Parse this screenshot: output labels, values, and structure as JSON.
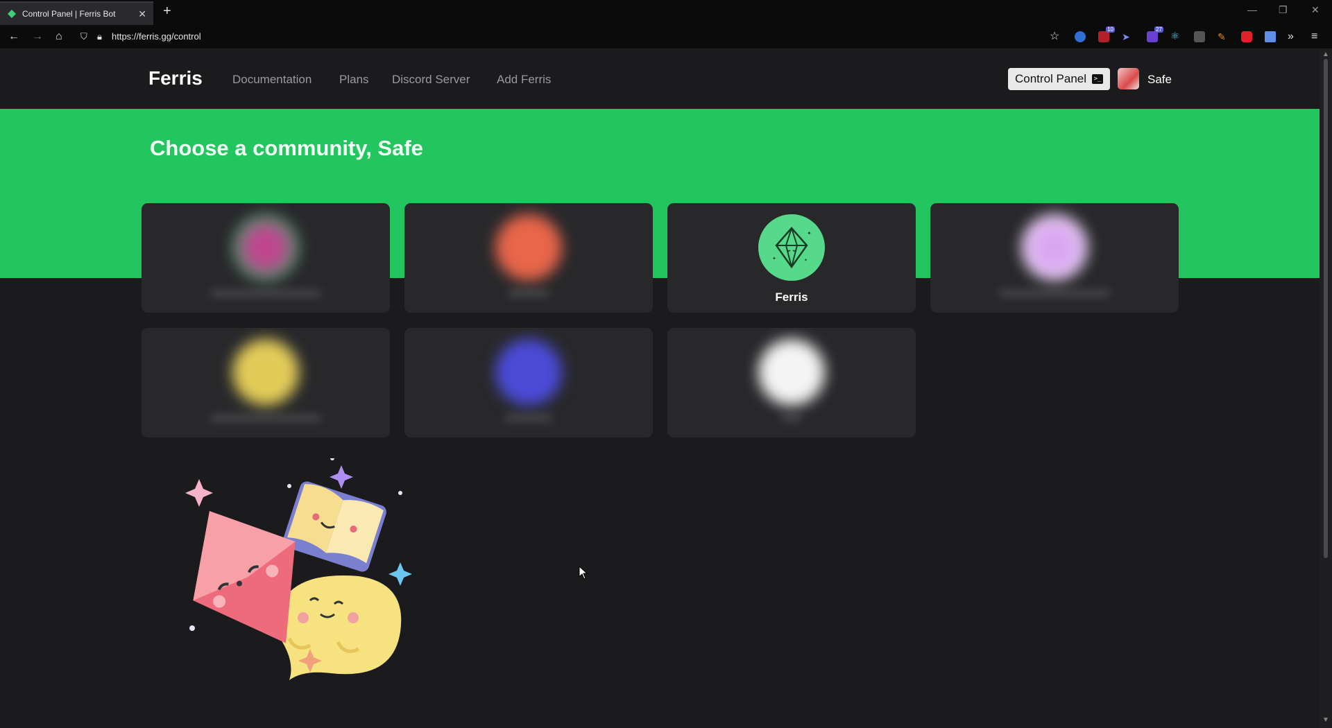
{
  "browser": {
    "tab_title": "Control Panel | Ferris Bot",
    "url": "https://ferris.gg/control",
    "extension_badges": [
      "10",
      "27"
    ]
  },
  "site": {
    "brand": "Ferris",
    "nav": [
      "Documentation",
      "Plans",
      "Discord Server",
      "Add Ferris"
    ],
    "control_panel_label": "Control Panel",
    "username": "Safe"
  },
  "hero": {
    "title": "Choose a community, Safe"
  },
  "communities": [
    {
      "name": "",
      "blurred": true,
      "color": "#b0508f"
    },
    {
      "name": "",
      "blurred": true,
      "color": "#e8664a"
    },
    {
      "name": "Ferris",
      "blurred": false,
      "color": "#56d98a"
    },
    {
      "name": "",
      "blurred": true,
      "color": "#d6a7f0"
    },
    {
      "name": "",
      "blurred": true,
      "color": "#e2cc59"
    },
    {
      "name": "",
      "blurred": true,
      "color": "#4b4bd8"
    },
    {
      "name": "",
      "blurred": true,
      "color": "#f4f4f4"
    }
  ],
  "colors": {
    "accent": "#23c55e",
    "background": "#1b1b1d",
    "card": "#28282b"
  }
}
